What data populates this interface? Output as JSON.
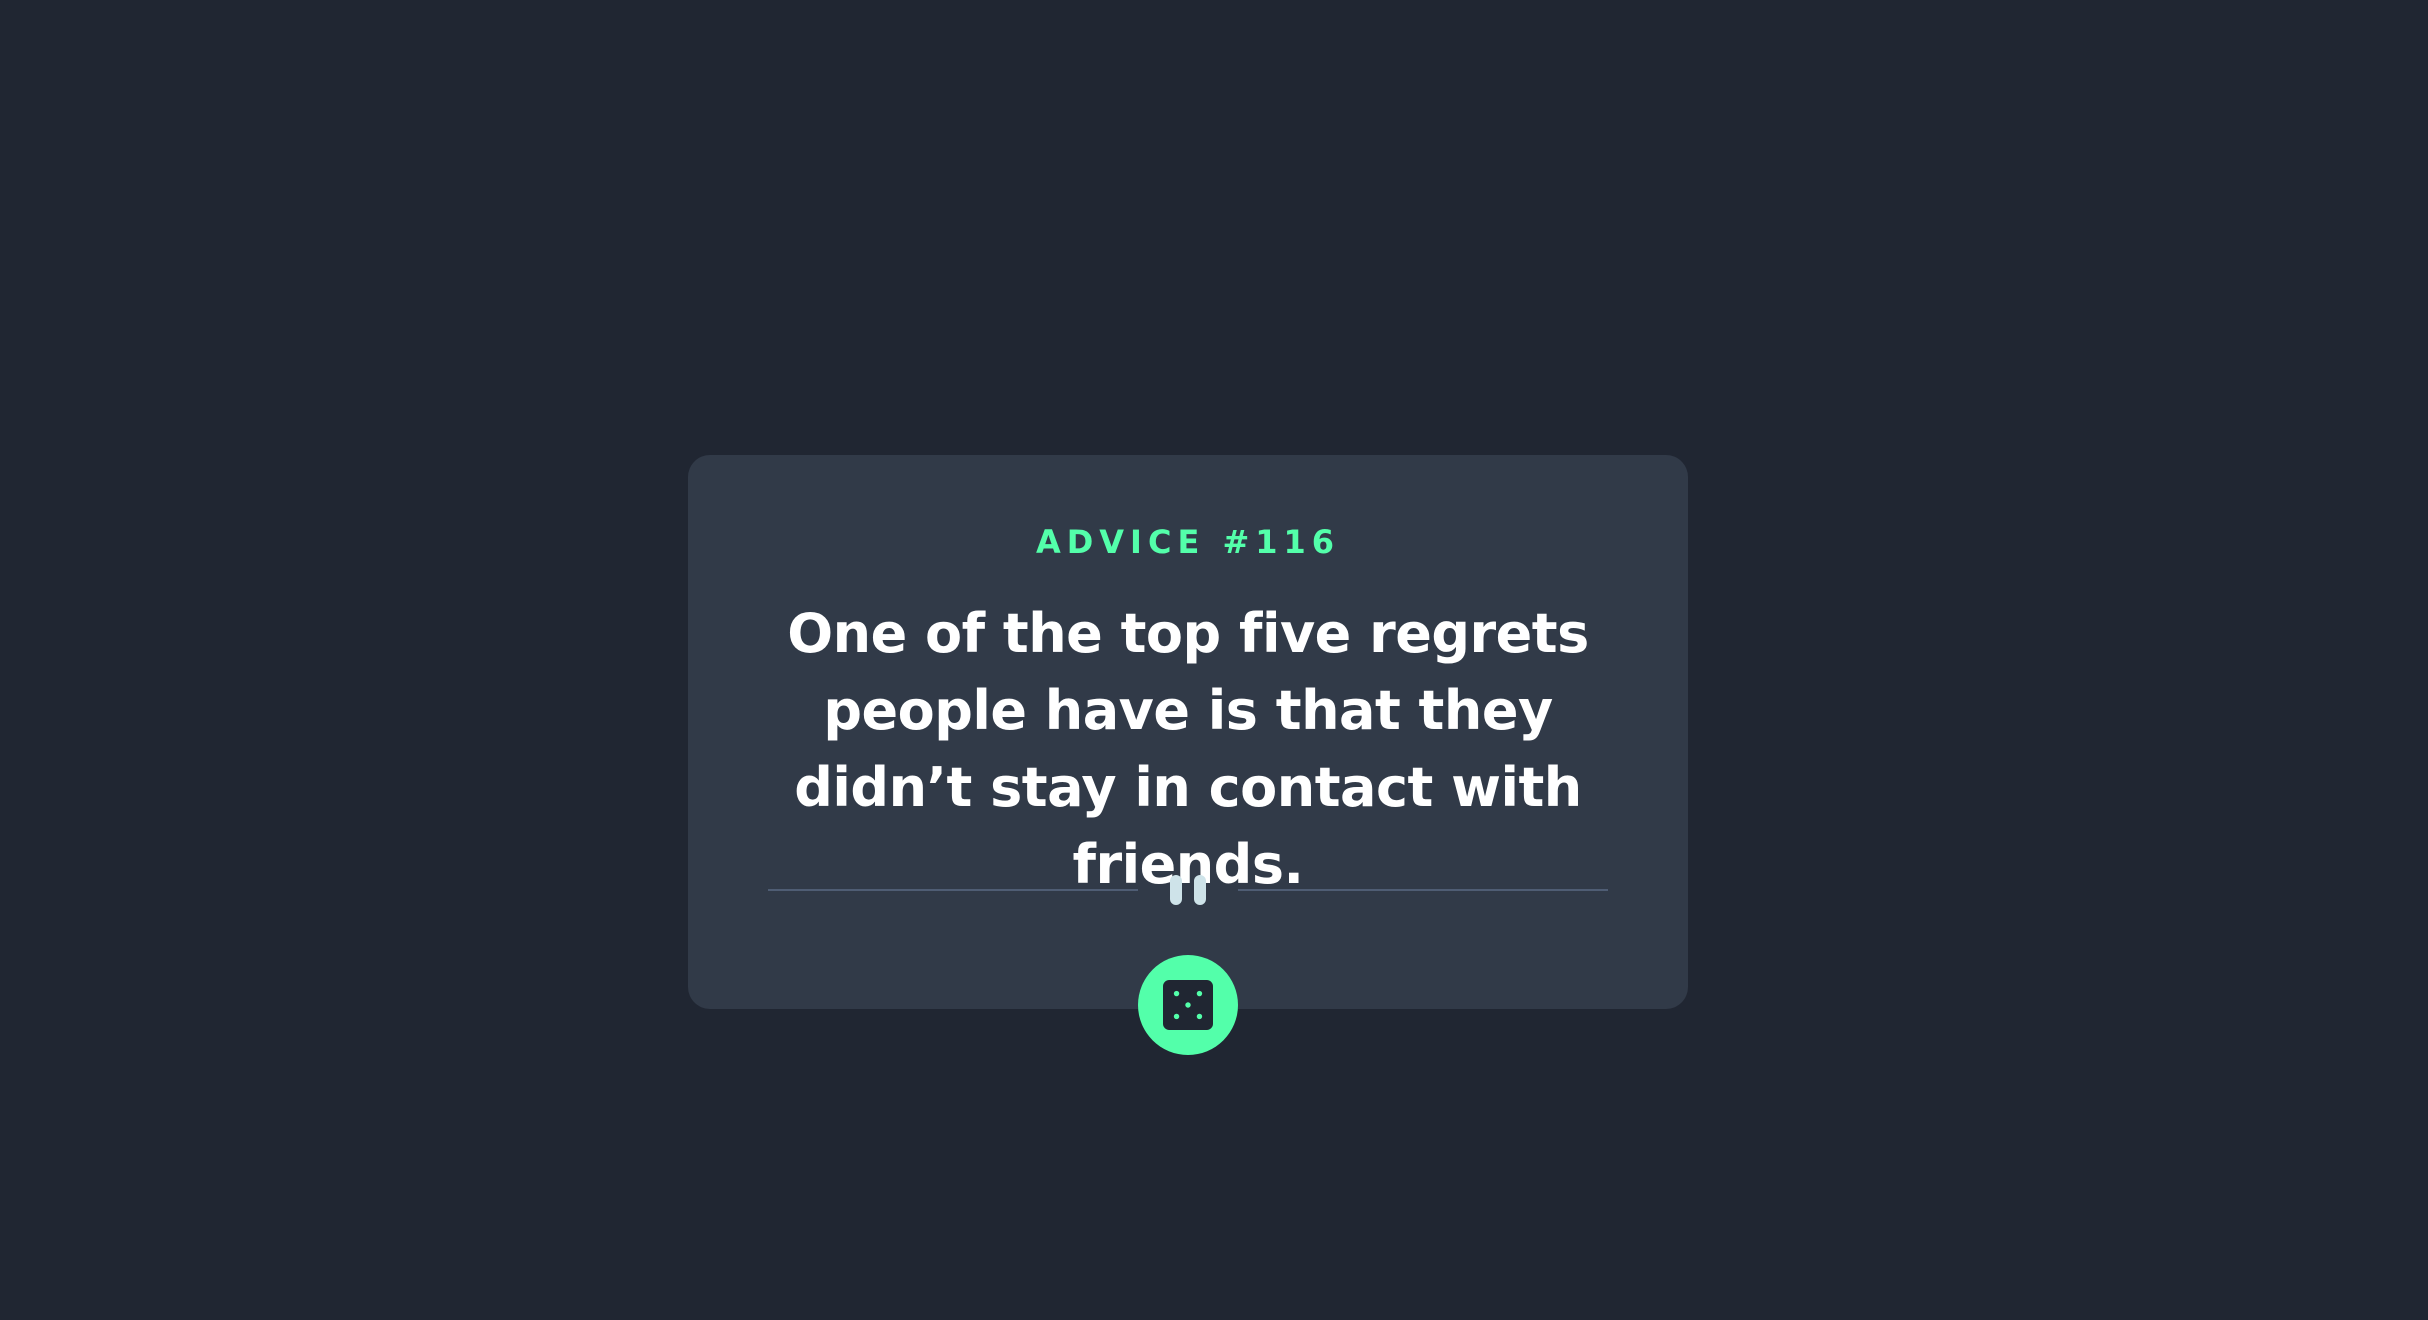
{
  "advice": {
    "heading": "ADVICE #116",
    "text": "One of the top five regrets people have is that they didn’t stay in contact with friends."
  },
  "divider": {
    "icon": "pause-icon"
  },
  "action": {
    "icon": "dice-icon",
    "aria_label": "Generate new advice"
  },
  "colors": {
    "background": "#202632",
    "card": "#313a48",
    "accent": "#53ffaa",
    "text": "#ffffff",
    "divider": "#4f5d74"
  }
}
